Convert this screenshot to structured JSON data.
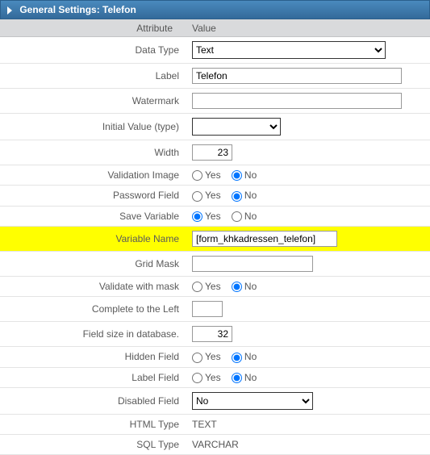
{
  "header": {
    "title": "General Settings: Telefon"
  },
  "columns": {
    "attribute": "Attribute",
    "value": "Value"
  },
  "labels": {
    "dataType": "Data Type",
    "label": "Label",
    "watermark": "Watermark",
    "initialValue": "Initial Value (type)",
    "width": "Width",
    "validationImage": "Validation Image",
    "passwordField": "Password Field",
    "saveVariable": "Save Variable",
    "variableName": "Variable Name",
    "gridMask": "Grid Mask",
    "validateWithMask": "Validate with mask",
    "completeLeft": "Complete to the Left",
    "fieldSize": "Field size in database.",
    "hiddenField": "Hidden Field",
    "labelField": "Label Field",
    "disabledField": "Disabled Field",
    "htmlType": "HTML Type",
    "sqlType": "SQL Type"
  },
  "values": {
    "dataType": "Text",
    "label": "Telefon",
    "watermark": "",
    "initialValue": "",
    "width": "23",
    "variableName": "[form_khkadressen_telefon]",
    "gridMask": "",
    "completeLeft": "",
    "fieldSize": "32",
    "disabledField": "No",
    "htmlType": "TEXT",
    "sqlType": "VARCHAR"
  },
  "options": {
    "yes": "Yes",
    "no": "No"
  }
}
